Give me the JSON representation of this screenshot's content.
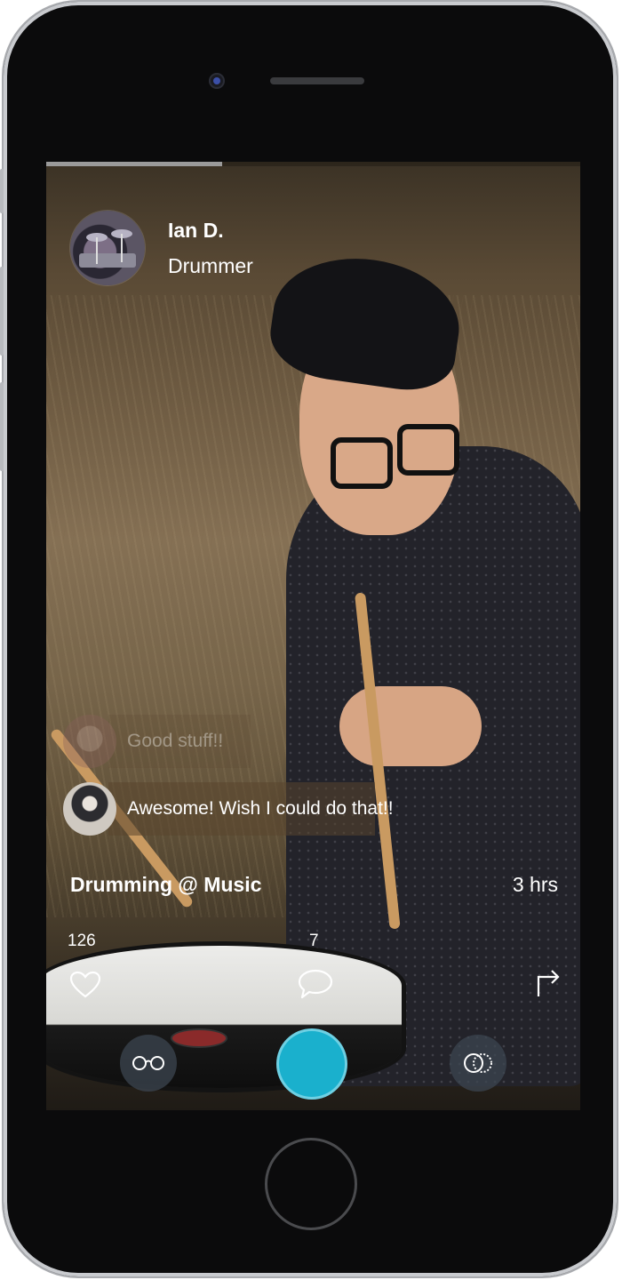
{
  "story": {
    "progress_fraction": 0.33,
    "author": {
      "name": "Ian D.",
      "subtitle": "Drummer",
      "avatar_icon": "drum-kit-avatar"
    },
    "comments": [
      {
        "text": "Good stuff!!",
        "faded": true,
        "avatar_icon": "user-avatar"
      },
      {
        "text": "Awesome! Wish I could do that!!",
        "faded": false,
        "avatar_icon": "user-avatar"
      }
    ],
    "title": "Drumming @ Music",
    "time": "3 hrs"
  },
  "actions": {
    "likes_count": "126",
    "comments_count": "7",
    "like_icon": "heart-icon",
    "comment_icon": "speech-bubble-icon",
    "share_icon": "share-arrow-icon"
  },
  "bottom_bar": {
    "left_icon": "glasses-icon",
    "center_button": "record-button",
    "right_icon": "overlapping-circles-icon",
    "accent": "#1ab0cd"
  },
  "colors": {
    "device": "#0b0b0c",
    "bezel": "#c9cbcf"
  }
}
